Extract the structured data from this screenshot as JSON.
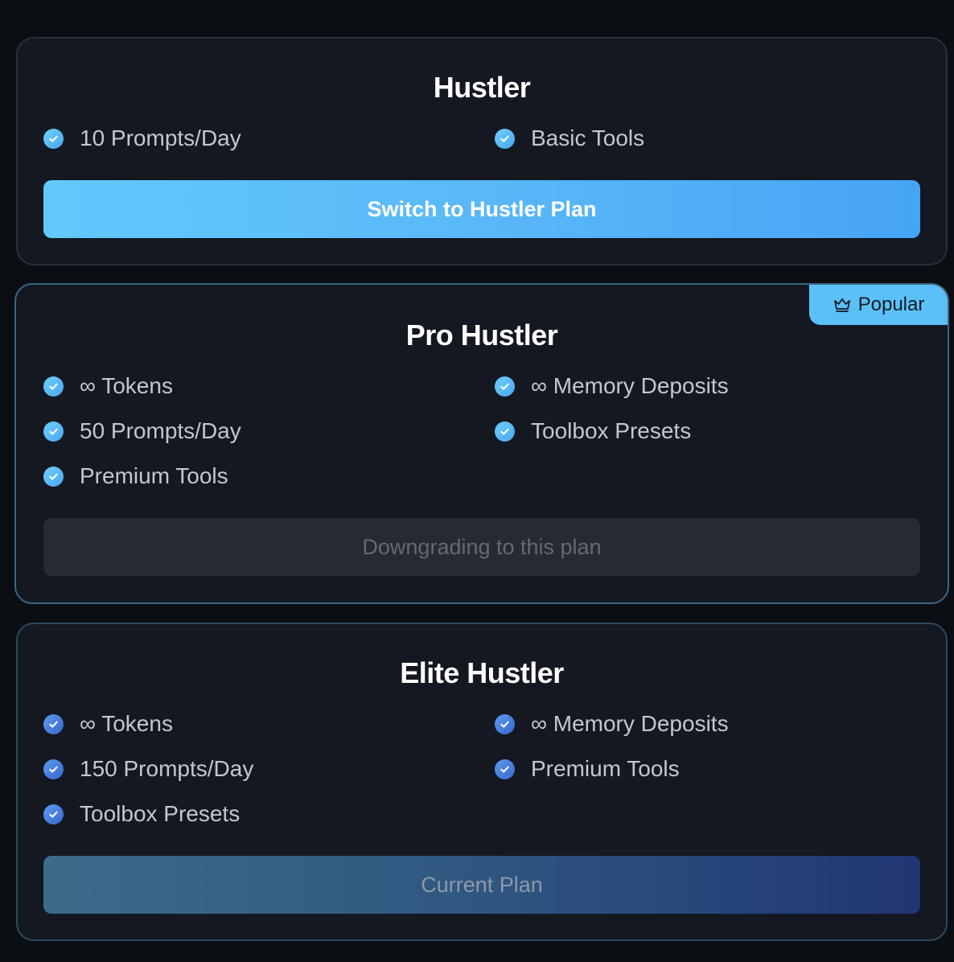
{
  "plans": [
    {
      "title": "Hustler",
      "features_left": [
        "10 Prompts/Day"
      ],
      "features_right": [
        "Basic Tools"
      ],
      "button_label": "Switch to Hustler Plan"
    },
    {
      "title": "Pro Hustler",
      "badge": {
        "icon": "crown-icon",
        "label": "Popular"
      },
      "features_left": [
        "∞ Tokens",
        "50 Prompts/Day",
        "Premium Tools"
      ],
      "features_right": [
        "∞ Memory Deposits",
        "Toolbox Presets"
      ],
      "button_label": "Downgrading to this plan"
    },
    {
      "title": "Elite Hustler",
      "features_left": [
        "∞ Tokens",
        "150 Prompts/Day",
        "Toolbox Presets"
      ],
      "features_right": [
        "∞ Memory Deposits",
        "Premium Tools"
      ],
      "button_label": "Current Plan"
    }
  ],
  "colors": {
    "background": "#0b0e13",
    "card": "#141821",
    "accent": "#5bc0f7",
    "check_light": "#5ab8f8",
    "check_dark": "#4a7fe0"
  },
  "icons": {
    "feature_check": "check-circle-icon"
  }
}
